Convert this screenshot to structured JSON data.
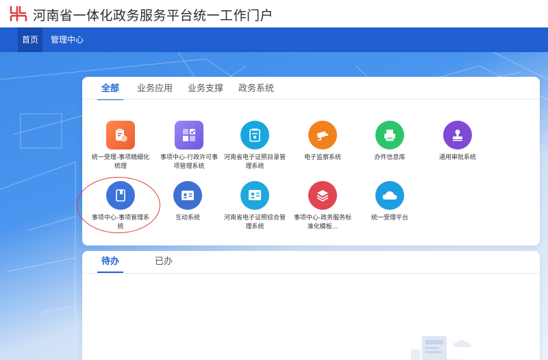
{
  "header": {
    "title": "河南省一体化政务服务平台统一工作门户"
  },
  "nav": {
    "items": [
      {
        "label": "首页",
        "active": true
      },
      {
        "label": "管理中心",
        "active": false
      }
    ]
  },
  "apps_card": {
    "tabs": [
      {
        "label": "全部",
        "active": true
      },
      {
        "label": "业务应用",
        "active": false
      },
      {
        "label": "业务支撑",
        "active": false
      },
      {
        "label": "政务系统",
        "active": false
      }
    ],
    "apps": [
      {
        "label": "统一受理-事项精细化梳理",
        "icon": "clipboard-edit-icon",
        "color": "#f06a3c"
      },
      {
        "label": "事项中心-行政许可事项管理系统",
        "icon": "grid-check-icon",
        "color": "#7b6ee8"
      },
      {
        "label": "河南省电子证照目录管理系统",
        "icon": "id-document-icon",
        "color": "#19a6dd"
      },
      {
        "label": "电子监察系统",
        "icon": "camera-icon",
        "color": "#f2811d"
      },
      {
        "label": "办件信息库",
        "icon": "printer-icon",
        "color": "#2ec46a"
      },
      {
        "label": "通用审批系统",
        "icon": "stamp-icon",
        "color": "#7f49d6"
      },
      {
        "label": "事项中心-事项管理系统",
        "icon": "book-icon",
        "color": "#3d73d8"
      },
      {
        "label": "互动系统",
        "icon": "contact-card-icon",
        "color": "#3e6fd4"
      },
      {
        "label": "河南省电子证照综合管理系统",
        "icon": "certificate-icon",
        "color": "#1ea8dc"
      },
      {
        "label": "事项中心-政务服务标准化模板...",
        "icon": "layers-icon",
        "color": "#e04550"
      },
      {
        "label": "统一受理平台",
        "icon": "cloud-icon",
        "color": "#1b9fe0"
      }
    ]
  },
  "todo_card": {
    "tabs": [
      {
        "label": "待办",
        "active": true
      },
      {
        "label": "已办",
        "active": false
      }
    ]
  },
  "colors": {
    "brand": "#1f5fd0",
    "logo": "#d9413d",
    "highlight": "#d9413d"
  }
}
